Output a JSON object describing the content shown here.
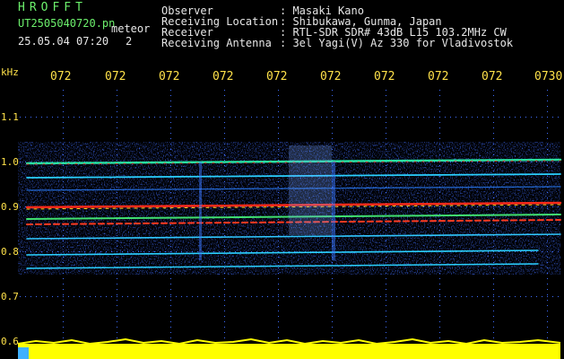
{
  "header": {
    "app_title": "HROFFT",
    "file_name": "UT2505040720.pn",
    "meteor_label": "meteor",
    "date_time": "25.05.04 07:20",
    "count": "2",
    "info": [
      {
        "label": "Observer",
        "value": ": Masaki Kano"
      },
      {
        "label": "Receiving Location",
        "value": ": Shibukawa, Gunma, Japan"
      },
      {
        "label": "Receiver",
        "value": ": RTL-SDR SDR# 43dB L15 103.2MHz CW"
      },
      {
        "label": "Receiving Antenna",
        "value": ": 3el Yagi(V) Az 330 for Vladivostok"
      }
    ]
  },
  "time_ticks": [
    "072",
    "072",
    "072",
    "072",
    "072",
    "072",
    "072",
    "072",
    "072",
    "0730"
  ],
  "y_axis": {
    "unit": "kHz",
    "labels": [
      "1.1",
      "1.0",
      "0.9",
      "0.8",
      "0.7",
      "0.6"
    ]
  },
  "colors": {
    "background": "#000000",
    "header_green": "#6cf06c",
    "tick_yellow": "#ffe24a",
    "signal_red": "#ff2a1a",
    "noise_blue": "#1430ff",
    "amplitude_yellow": "#ffff00"
  }
}
